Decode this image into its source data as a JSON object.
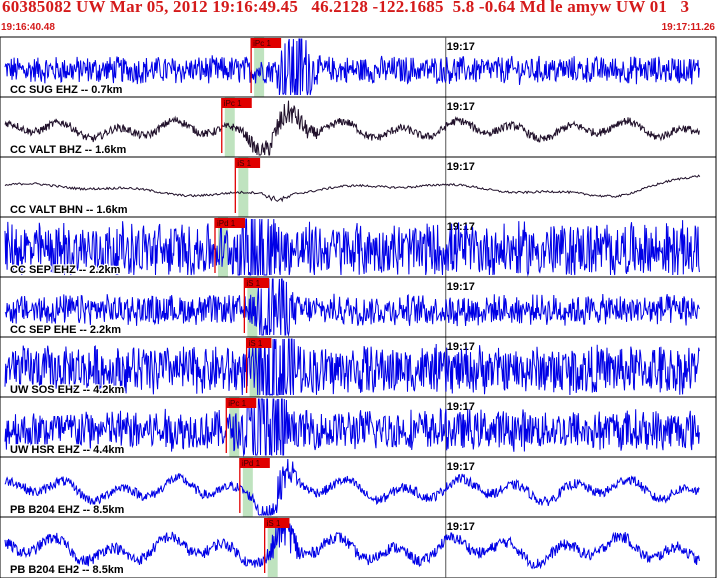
{
  "header": {
    "title": "60385082 UW Mar 05, 2012 19:16:49.45   46.2128 -122.1685  5.8 -0.64 Md le amyw UW 01   3",
    "start_time": "19:16:40.48",
    "end_time": "19:17:11.26"
  },
  "colors": {
    "header_text": "#d41a1a",
    "trace_blue": "#0000e6",
    "trace_dark": "#20102a",
    "pick_red": "#e00000",
    "band_green": "#bfe3bf"
  },
  "chart_data": {
    "type": "line",
    "x_start": "19:16:40.48",
    "x_end": "19:17:11.26",
    "minute_tick": {
      "label": "19:17",
      "time_offset_s": 19.52
    },
    "grid": "minute line and panel separators",
    "channels": [
      {
        "label": "CC SUG EHZ -- 0.7km",
        "pick": "iPc 1",
        "pick_time_s": 10.9,
        "trace_color": "blue",
        "style": "noise",
        "amplitude": 0.5,
        "burst": [
          12.0,
          14.5
        ],
        "burst_amp": 1.6
      },
      {
        "label": "CC VALT BHZ -- 1.6km",
        "pick": "iPc 1",
        "pick_time_s": 9.6,
        "trace_color": "dark",
        "style": "wave",
        "amplitude": 0.45,
        "burst": [
          10.5,
          15.5
        ],
        "burst_amp": 1.2
      },
      {
        "label": "CC VALT BHN -- 1.6km",
        "pick": "iS 1",
        "pick_time_s": 10.2,
        "trace_color": "dark",
        "style": "drift",
        "amplitude": 0.3,
        "burst": [
          11.3,
          13.5
        ],
        "burst_amp": 0.8
      },
      {
        "label": "CC SEP EHZ -- 2.2km",
        "pick": "iPd 1",
        "pick_time_s": 9.3,
        "trace_color": "blue",
        "style": "noise",
        "amplitude": 1.0,
        "burst": [
          10.0,
          13.0
        ],
        "burst_amp": 1.3
      },
      {
        "label": "CC SEP EHE -- 2.2km",
        "pick": "iS 1",
        "pick_time_s": 10.6,
        "trace_color": "blue",
        "style": "noise",
        "amplitude": 0.55,
        "burst": [
          11.0,
          13.5
        ],
        "burst_amp": 1.6
      },
      {
        "label": "UW SOS EHZ -- 4.2km",
        "pick": "iS 1",
        "pick_time_s": 10.7,
        "trace_color": "blue",
        "style": "noise",
        "amplitude": 0.9,
        "burst": [
          11.0,
          14.0
        ],
        "burst_amp": 1.3
      },
      {
        "label": "UW HSR EHZ -- 4.4km",
        "pick": "iPc 1",
        "pick_time_s": 9.8,
        "trace_color": "blue",
        "style": "noise",
        "amplitude": 0.75,
        "burst": [
          10.5,
          13.5
        ],
        "burst_amp": 1.6
      },
      {
        "label": "PB B204 EHZ -- 8.5km",
        "pick": "iPd 1",
        "pick_time_s": 10.4,
        "trace_color": "blue",
        "style": "wave",
        "amplitude": 0.55,
        "burst": [
          11.0,
          14.0
        ],
        "burst_amp": 1.4
      },
      {
        "label": "PB B204 EH2 -- 8.5km",
        "pick": "iS 1",
        "pick_time_s": 11.5,
        "trace_color": "blue",
        "style": "wave",
        "amplitude": 0.65,
        "burst": [
          11.5,
          14.0
        ],
        "burst_amp": 1.4
      }
    ]
  }
}
